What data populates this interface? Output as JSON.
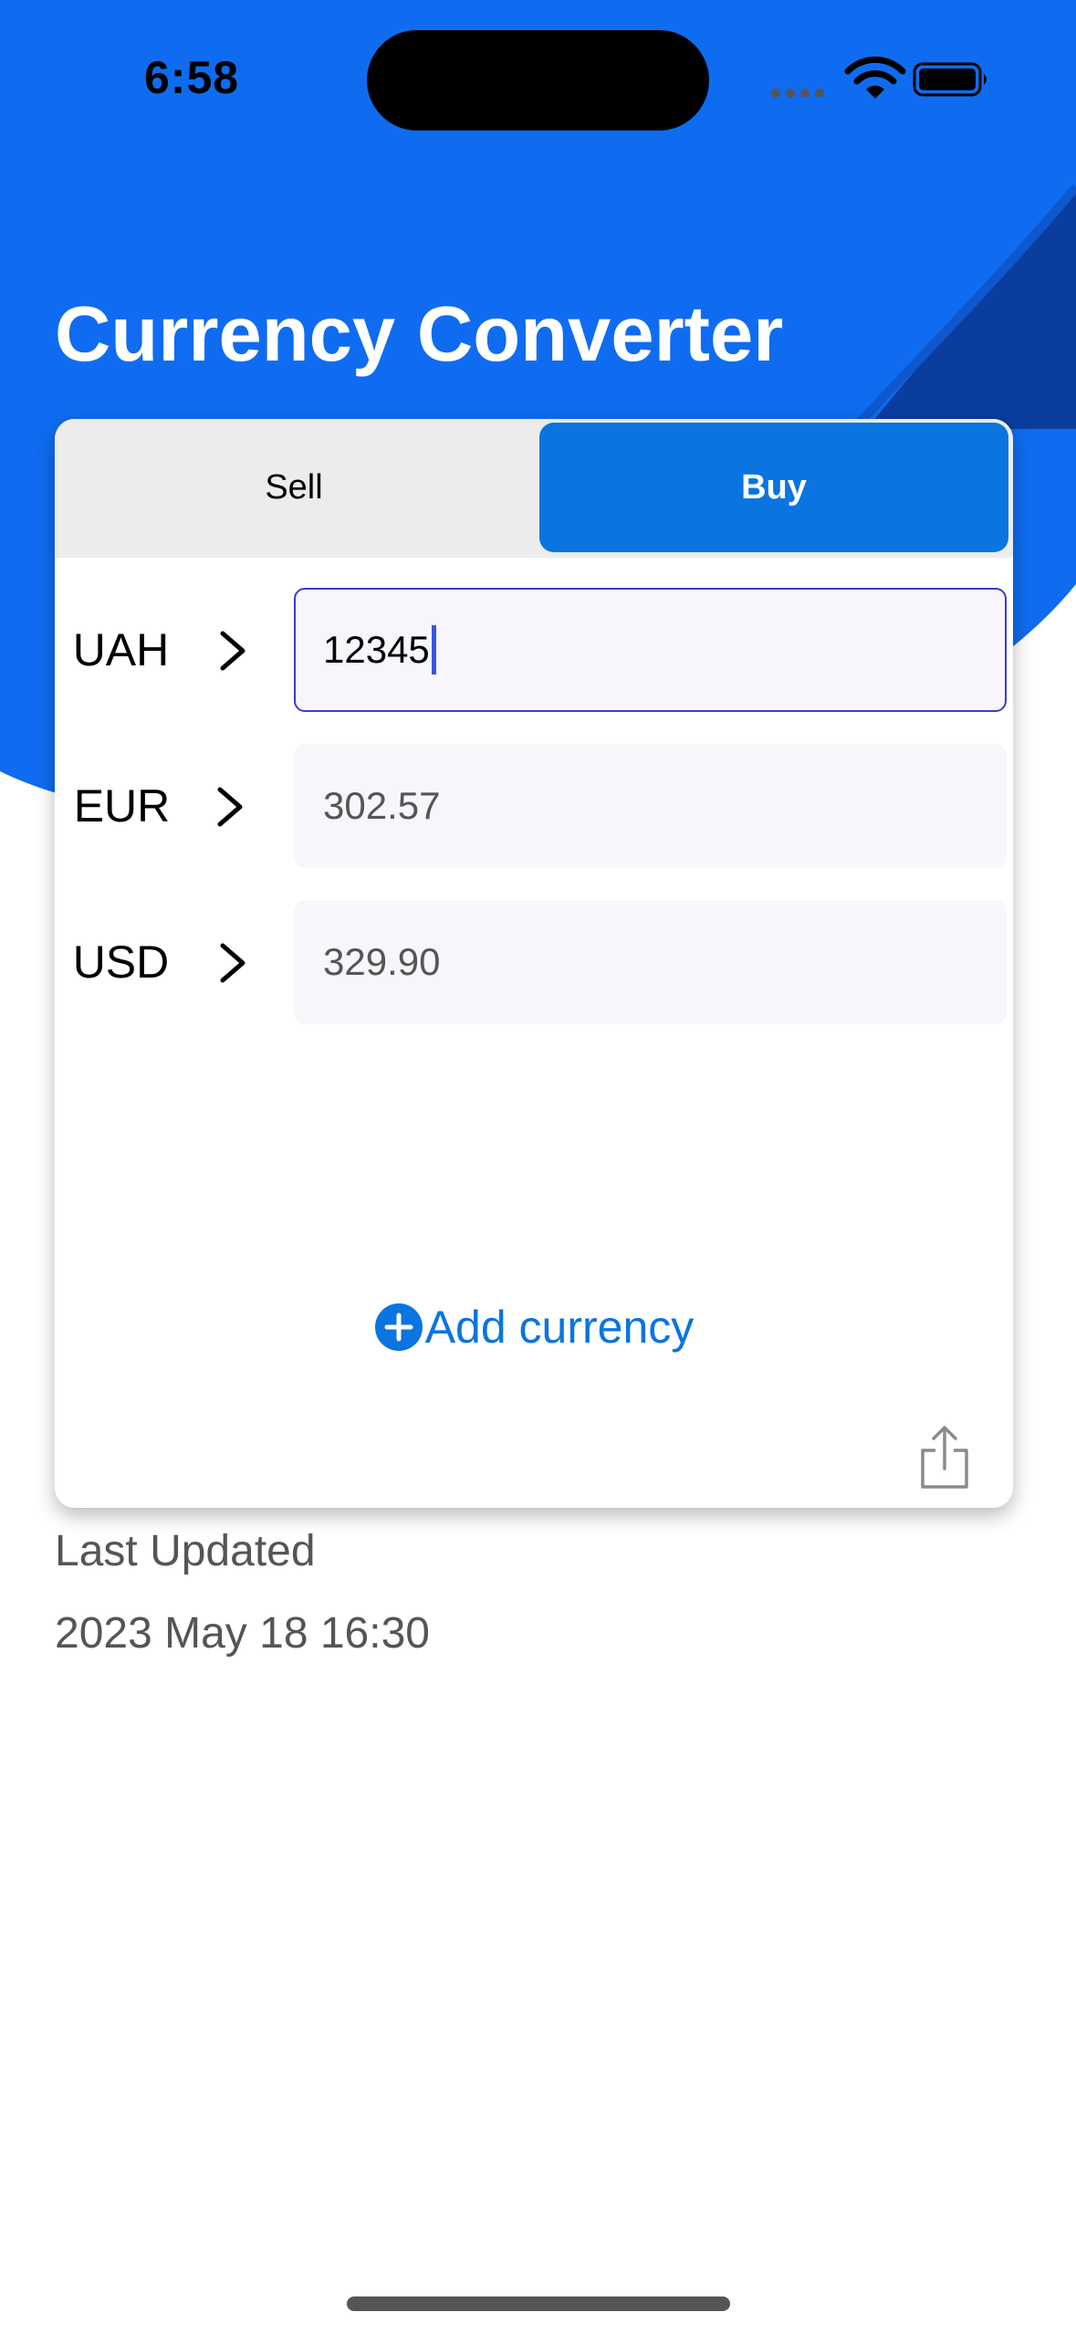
{
  "status_bar": {
    "time": "6:58",
    "icons": [
      "signal-dots-icon",
      "wifi-icon",
      "battery-icon"
    ]
  },
  "colors": {
    "accent": "#0a74e1",
    "header_blue": "#0f6cf0",
    "header_dark_blue": "#0a3d9e",
    "field_bg": "#f8f6fb",
    "active_border": "#3a3ad0"
  },
  "header": {
    "title": "Currency Converter"
  },
  "segment": {
    "sell_label": "Sell",
    "buy_label": "Buy",
    "selected": "Buy"
  },
  "rows": [
    {
      "code": "UAH",
      "value": "12345",
      "active": true
    },
    {
      "code": "EUR",
      "value": "302.57",
      "active": false
    },
    {
      "code": "USD",
      "value": "329.90",
      "active": false
    }
  ],
  "add_currency": {
    "label": "Add currency",
    "icon": "plus-circle-icon"
  },
  "share": {
    "icon": "share-icon"
  },
  "info": {
    "last_updated_label": "Last Updated",
    "last_updated_value": "2023 May 18 16:30"
  }
}
